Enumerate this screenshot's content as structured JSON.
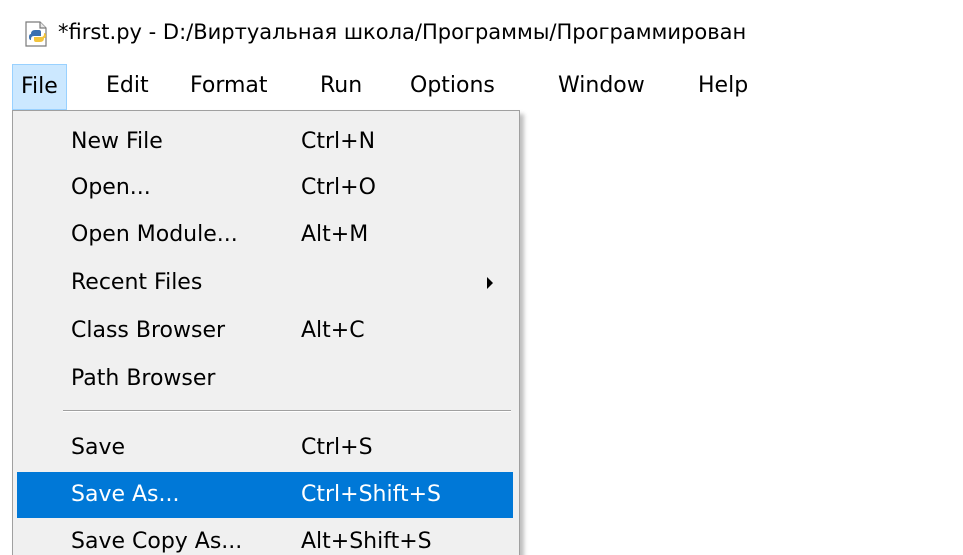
{
  "window": {
    "title": "*first.py - D:/Виртуальная школа/Программы/Программирован"
  },
  "icons": {
    "app": "python-file-icon",
    "submenu": "chevron-right-icon"
  },
  "colors": {
    "highlight": "#0078d7",
    "menubar_active": "#cce8ff",
    "menu_background": "#f0f0f0"
  },
  "menubar": {
    "items": [
      {
        "label": "File"
      },
      {
        "label": "Edit"
      },
      {
        "label": "Format"
      },
      {
        "label": "Run"
      },
      {
        "label": "Options"
      },
      {
        "label": "Window"
      },
      {
        "label": "Help"
      }
    ]
  },
  "file_menu": {
    "items": [
      {
        "label": "New File",
        "shortcut": "Ctrl+N"
      },
      {
        "label": "Open...",
        "shortcut": "Ctrl+O"
      },
      {
        "label": "Open Module...",
        "shortcut": "Alt+M"
      },
      {
        "label": "Recent Files",
        "shortcut": ""
      },
      {
        "label": "Class Browser",
        "shortcut": "Alt+C"
      },
      {
        "label": "Path Browser",
        "shortcut": ""
      },
      {
        "label": "Save",
        "shortcut": "Ctrl+S"
      },
      {
        "label": "Save As...",
        "shortcut": "Ctrl+Shift+S"
      },
      {
        "label": "Save Copy As...",
        "shortcut": "Alt+Shift+S"
      }
    ]
  }
}
